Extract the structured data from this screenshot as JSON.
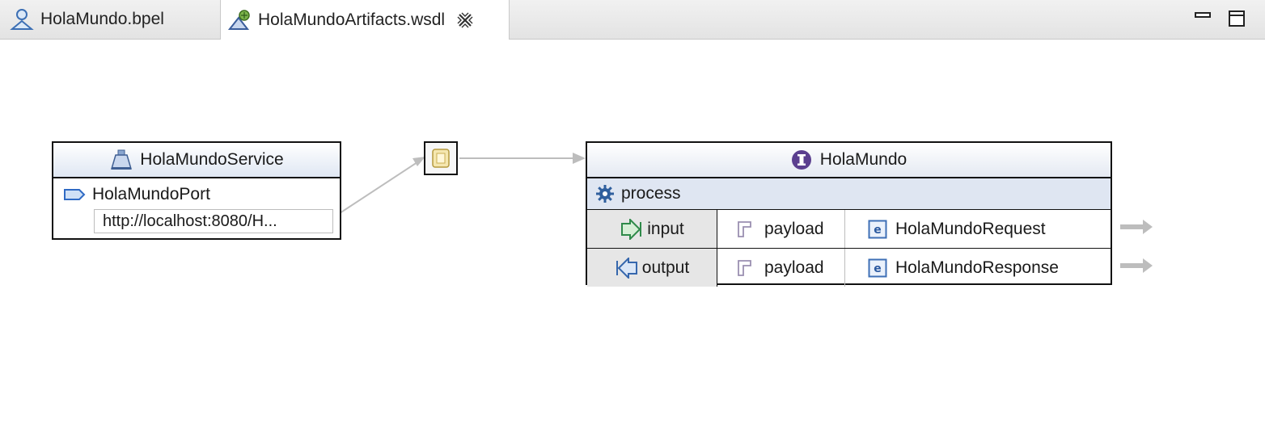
{
  "tabs": [
    {
      "label": "HolaMundo.bpel",
      "icon": "bpel-process-icon",
      "active": false
    },
    {
      "label": "HolaMundoArtifacts.wsdl",
      "icon": "wsdl-file-icon",
      "active": true
    }
  ],
  "window_controls": {
    "minimize_icon": "minimize-icon",
    "maximize_icon": "maximize-icon"
  },
  "service": {
    "name": "HolaMundoService",
    "port": "HolaMundoPort",
    "address": "http://localhost:8080/H..."
  },
  "interface": {
    "name": "HolaMundo",
    "operation": "process",
    "messages": [
      {
        "direction": "input",
        "part": "payload",
        "element": "HolaMundoRequest"
      },
      {
        "direction": "output",
        "part": "payload",
        "element": "HolaMundoResponse"
      }
    ]
  },
  "colors": {
    "header_gradient_end": "#dfe7f3",
    "operation_row": "#dfe6f2",
    "direction_cell": "#e6e6e6",
    "connector": "#bdbdbd",
    "interface_icon": "#5b3f8f"
  }
}
